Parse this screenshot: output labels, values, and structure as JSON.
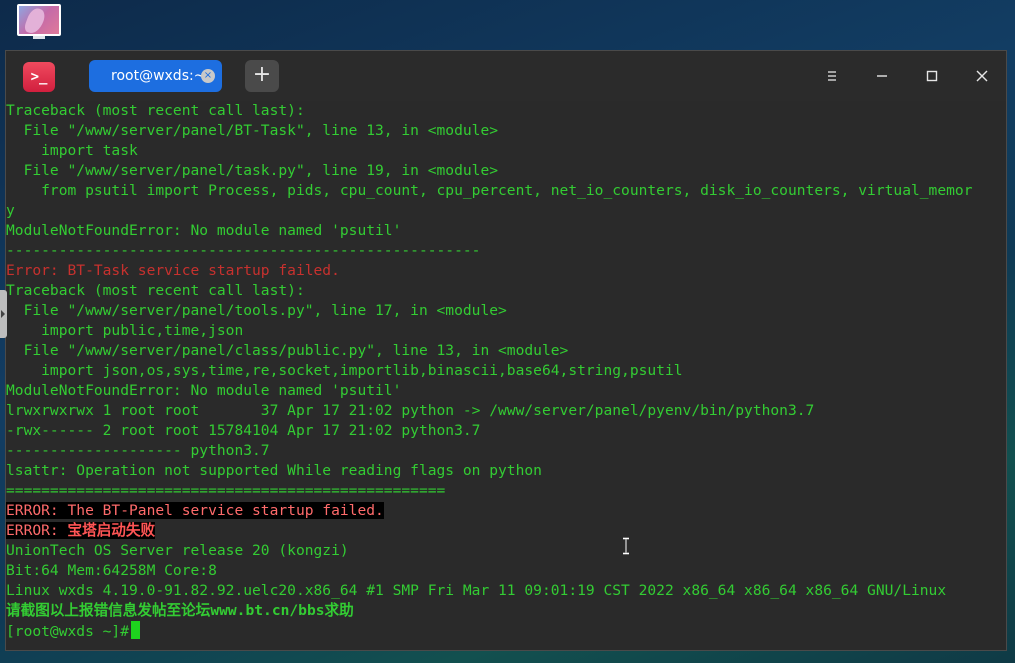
{
  "app": {
    "icon_glyph": ">_"
  },
  "tabs": [
    {
      "label": "root@wxds:~",
      "close_glyph": "×"
    }
  ],
  "new_tab_glyph": "+",
  "window_controls": {
    "menu_icon": "hamburger-menu-icon",
    "minimize_icon": "minimize-icon",
    "maximize_icon": "maximize-icon",
    "close_icon": "close-icon"
  },
  "colors": {
    "terminal_text": "#33cc33",
    "error_text": "#c7312e",
    "highlight_error": "#ff6b6b",
    "tab_active": "#1d6ee0",
    "app_icon": "#e0304a"
  },
  "terminal": {
    "lines": [
      {
        "text": "Traceback (most recent call last):",
        "style": "green"
      },
      {
        "text": "  File \"/www/server/panel/BT-Task\", line 13, in <module>",
        "style": "green"
      },
      {
        "text": "    import task",
        "style": "green"
      },
      {
        "text": "  File \"/www/server/panel/task.py\", line 19, in <module>",
        "style": "green"
      },
      {
        "text": "    from psutil import Process, pids, cpu_count, cpu_percent, net_io_counters, disk_io_counters, virtual_memor",
        "style": "green"
      },
      {
        "text": "y",
        "style": "green"
      },
      {
        "text": "ModuleNotFoundError: No module named 'psutil'",
        "style": "green"
      },
      {
        "text": "------------------------------------------------------",
        "style": "green"
      },
      {
        "text": "Error: BT-Task service startup failed.",
        "style": "red"
      },
      {
        "text": "Traceback (most recent call last):",
        "style": "green"
      },
      {
        "text": "  File \"/www/server/panel/tools.py\", line 17, in <module>",
        "style": "green"
      },
      {
        "text": "    import public,time,json",
        "style": "green"
      },
      {
        "text": "  File \"/www/server/panel/class/public.py\", line 13, in <module>",
        "style": "green"
      },
      {
        "text": "    import json,os,sys,time,re,socket,importlib,binascii,base64,string,psutil",
        "style": "green"
      },
      {
        "text": "ModuleNotFoundError: No module named 'psutil'",
        "style": "green"
      },
      {
        "text": "lrwxrwxrwx 1 root root       37 Apr 17 21:02 python -> /www/server/panel/pyenv/bin/python3.7",
        "style": "green"
      },
      {
        "text": "-rwx------ 2 root root 15784104 Apr 17 21:02 python3.7",
        "style": "green"
      },
      {
        "text": "-------------------- python3.7",
        "style": "green"
      },
      {
        "text": "lsattr: Operation not supported While reading flags on python",
        "style": "green"
      },
      {
        "text": "==================================================",
        "style": "green"
      },
      {
        "text": "ERROR: The BT-Panel service startup failed.",
        "style": "err"
      },
      {
        "text": "ERROR: 宝塔启动失败",
        "style": "errmix"
      },
      {
        "text": "UnionTech OS Server release 20 (kongzi)",
        "style": "green"
      },
      {
        "text": "Bit:64 Mem:64258M Core:8",
        "style": "green"
      },
      {
        "text": "Linux wxds 4.19.0-91.82.92.uelc20.x86_64 #1 SMP Fri Mar 11 09:01:19 CST 2022 x86_64 x86_64 x86_64 GNU/Linux",
        "style": "green"
      },
      {
        "text": "请截图以上报错信息发帖至论坛www.bt.cn/bbs求助",
        "style": "boldgreen"
      },
      {
        "text": "[root@wxds ~]# ",
        "style": "prompt"
      }
    ]
  }
}
